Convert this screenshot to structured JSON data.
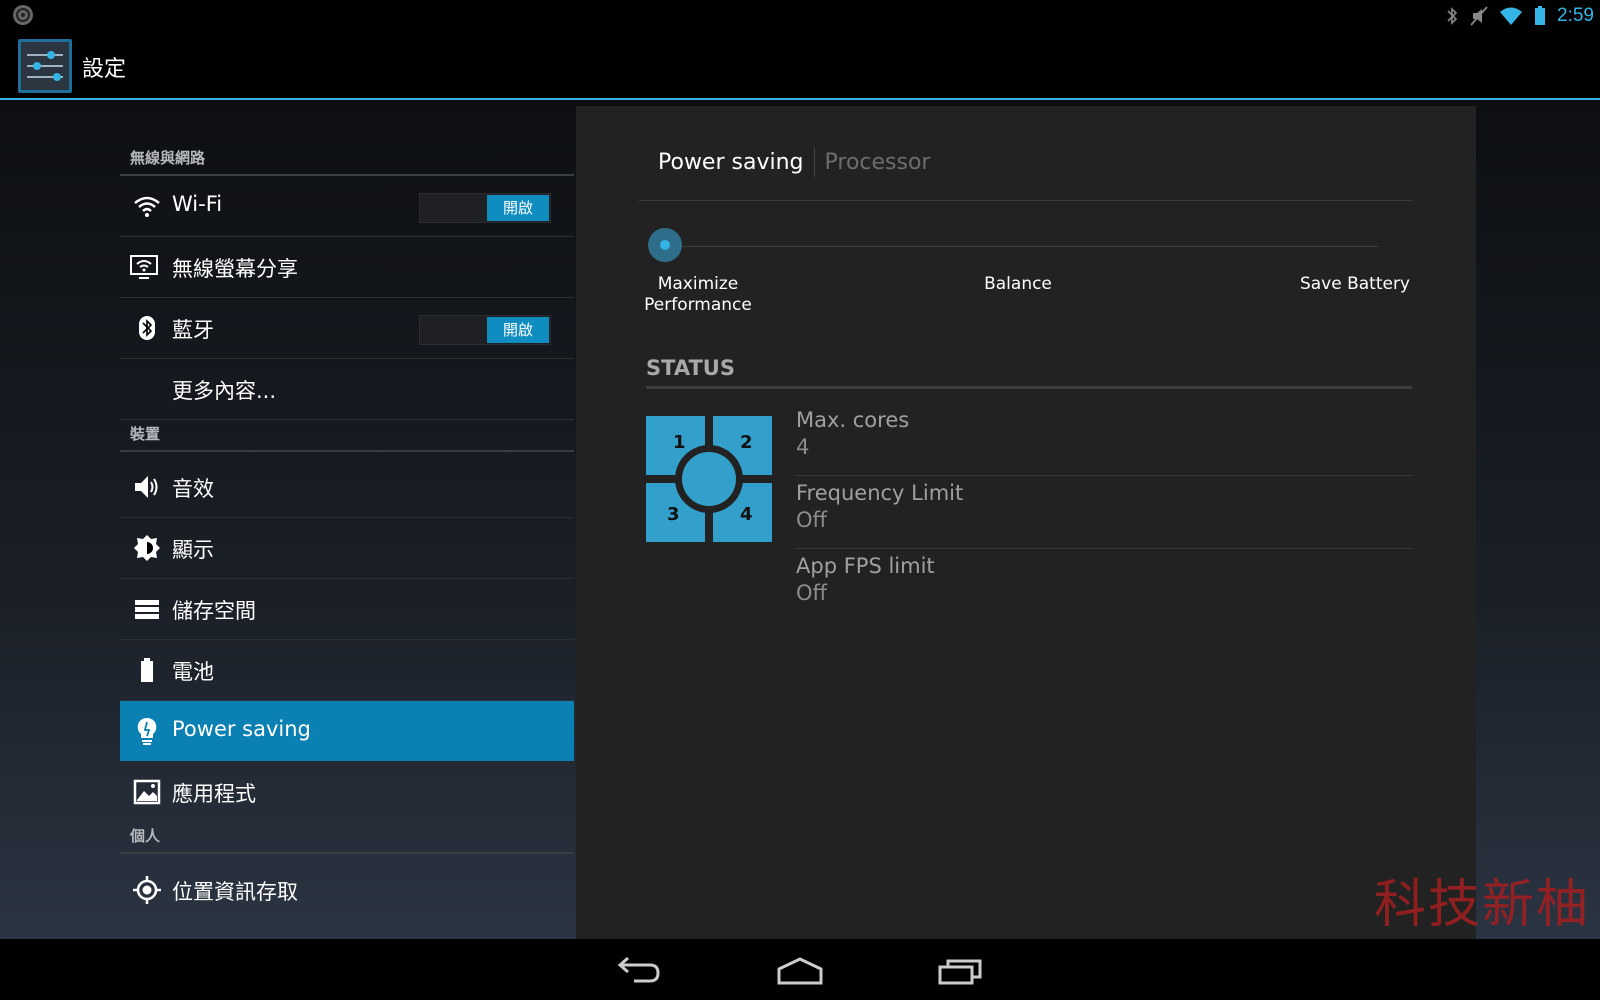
{
  "status_bar": {
    "time": "2:59",
    "icons": [
      "android-debug-icon",
      "bluetooth-icon",
      "mute-icon",
      "wifi-icon",
      "battery-icon"
    ]
  },
  "action_bar": {
    "title": "設定",
    "icon": "settings-sliders-icon"
  },
  "sidebar": {
    "sections": [
      {
        "header": "無線與網路"
      },
      {
        "header": "裝置"
      },
      {
        "header": "個人"
      }
    ],
    "items": [
      {
        "label": "Wi-Fi",
        "icon": "wifi-icon",
        "toggle": "開啟"
      },
      {
        "label": "無線螢幕分享",
        "icon": "screen-share-icon"
      },
      {
        "label": "藍牙",
        "icon": "bluetooth-icon",
        "toggle": "開啟"
      },
      {
        "label": "更多內容..."
      },
      {
        "label": "音效",
        "icon": "speaker-icon"
      },
      {
        "label": "顯示",
        "icon": "brightness-icon"
      },
      {
        "label": "儲存空間",
        "icon": "storage-icon"
      },
      {
        "label": "電池",
        "icon": "battery-icon"
      },
      {
        "label": "Power saving",
        "icon": "lightbulb-icon",
        "selected": true
      },
      {
        "label": "應用程式",
        "icon": "apps-icon"
      },
      {
        "label": "位置資訊存取",
        "icon": "location-icon"
      }
    ]
  },
  "panel": {
    "tabs": [
      {
        "label": "Power saving",
        "selected": true
      },
      {
        "label": "Processor",
        "selected": false
      }
    ],
    "slider": {
      "options": [
        "Maximize Performance",
        "Balance",
        "Save Battery"
      ],
      "selected_index": 0
    },
    "status": {
      "title": "STATUS",
      "cores": [
        "1",
        "2",
        "3",
        "4"
      ],
      "rows": [
        {
          "label": "Max. cores",
          "value": "4"
        },
        {
          "label": "Frequency Limit",
          "value": "Off"
        },
        {
          "label": "App FPS limit",
          "value": "Off"
        }
      ]
    }
  },
  "watermark": "科技新柚",
  "nav_bar": {
    "buttons": [
      "back-icon",
      "home-icon",
      "recent-apps-icon"
    ]
  },
  "colors": {
    "accent": "#33b5e5",
    "selected_bg": "#0a80b3",
    "toggle_on": "#0f8cc0",
    "watermark": "#a51f1f"
  }
}
